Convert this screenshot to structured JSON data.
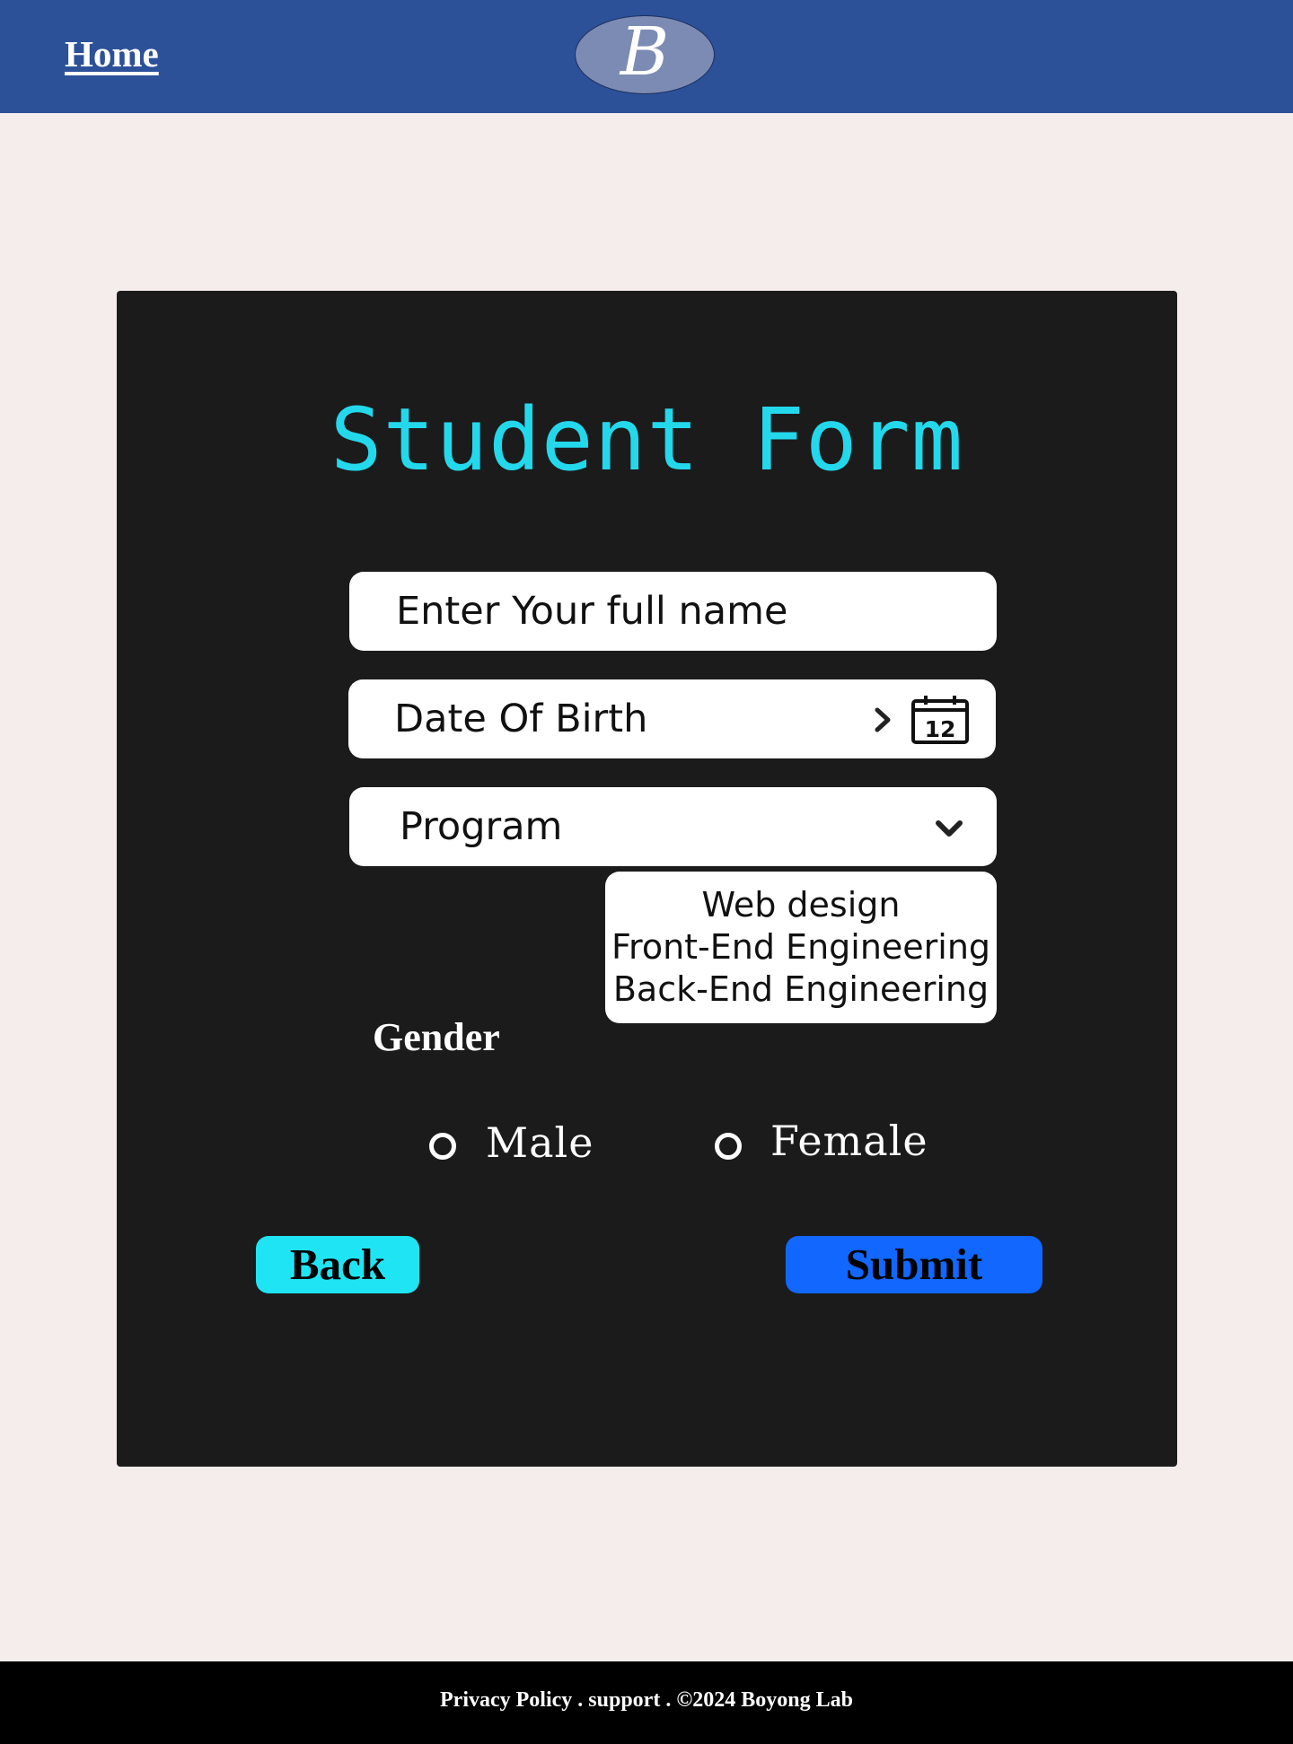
{
  "header": {
    "home_label": "Home",
    "logo_letter": "B",
    "background_color": "#2c5199"
  },
  "form": {
    "title": "Student Form",
    "name_placeholder": "Enter Your full name",
    "dob_placeholder": "Date Of Birth",
    "calendar_day": "12",
    "program_placeholder": "Program",
    "program_options": [
      "Web design",
      "Front-End Engineering",
      "Back-End Engineering"
    ],
    "gender_label": "Gender",
    "gender_options": [
      "Male",
      "Female"
    ],
    "back_label": "Back",
    "submit_label": "Submit",
    "title_color": "#24d8ec",
    "back_color": "#1fe4f3",
    "submit_color": "#1167ff"
  },
  "icons": {
    "dob_arrow": "chevron-right-icon",
    "dob_calendar": "calendar-icon",
    "program_arrow": "chevron-down-icon"
  },
  "footer": {
    "text": "Privacy Policy . support . ©2024 Boyong Lab"
  }
}
